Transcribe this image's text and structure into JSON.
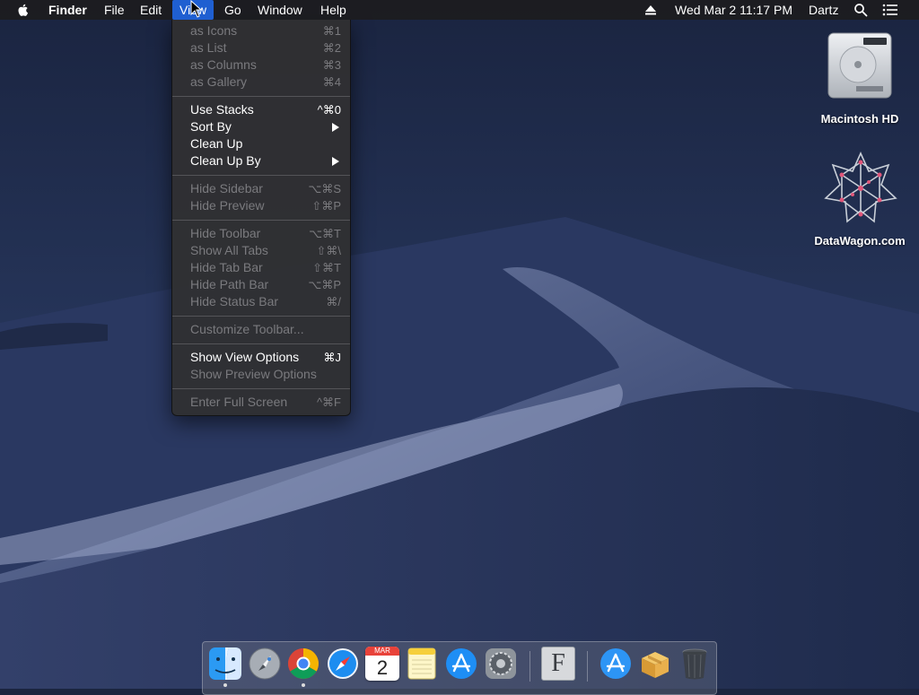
{
  "menubar": {
    "app_name": "Finder",
    "menus": [
      "File",
      "Edit",
      "View",
      "Go",
      "Window",
      "Help"
    ],
    "active_menu": "View",
    "clock": "Wed Mar 2  11:17 PM",
    "user": "Dartz"
  },
  "view_menu": {
    "items": [
      {
        "label": "as Icons",
        "shortcut": "⌘1",
        "enabled": false
      },
      {
        "label": "as List",
        "shortcut": "⌘2",
        "enabled": false
      },
      {
        "label": "as Columns",
        "shortcut": "⌘3",
        "enabled": false
      },
      {
        "label": "as Gallery",
        "shortcut": "⌘4",
        "enabled": false
      },
      {
        "label": "Use Stacks",
        "shortcut": "^⌘0",
        "enabled": true
      },
      {
        "label": "Sort By",
        "shortcut": "",
        "enabled": true,
        "submenu": true
      },
      {
        "label": "Clean Up",
        "shortcut": "",
        "enabled": true
      },
      {
        "label": "Clean Up By",
        "shortcut": "",
        "enabled": true,
        "submenu": true
      },
      {
        "label": "Hide Sidebar",
        "shortcut": "⌥⌘S",
        "enabled": false
      },
      {
        "label": "Hide Preview",
        "shortcut": "⇧⌘P",
        "enabled": false
      },
      {
        "label": "Hide Toolbar",
        "shortcut": "⌥⌘T",
        "enabled": false
      },
      {
        "label": "Show All Tabs",
        "shortcut": "⇧⌘\\",
        "enabled": false
      },
      {
        "label": "Hide Tab Bar",
        "shortcut": "⇧⌘T",
        "enabled": false
      },
      {
        "label": "Hide Path Bar",
        "shortcut": "⌥⌘P",
        "enabled": false
      },
      {
        "label": "Hide Status Bar",
        "shortcut": "⌘/",
        "enabled": false
      },
      {
        "label": "Customize Toolbar...",
        "shortcut": "",
        "enabled": false
      },
      {
        "label": "Show View Options",
        "shortcut": "⌘J",
        "enabled": true
      },
      {
        "label": "Show Preview Options",
        "shortcut": "",
        "enabled": false
      },
      {
        "label": "Enter Full Screen",
        "shortcut": "^⌘F",
        "enabled": false
      }
    ]
  },
  "desktop": {
    "icons": [
      {
        "label": "Macintosh HD",
        "icon": "hard-drive-icon"
      },
      {
        "label": "DataWagon.com",
        "icon": "network-star-icon"
      }
    ]
  },
  "dock": {
    "apps": [
      {
        "icon": "finder-icon",
        "running": true
      },
      {
        "icon": "launchpad-icon",
        "running": false
      },
      {
        "icon": "chrome-icon",
        "running": true
      },
      {
        "icon": "safari-icon",
        "running": false
      },
      {
        "icon": "calendar-icon",
        "running": false,
        "month": "MAR",
        "day": "2"
      },
      {
        "icon": "notes-icon",
        "running": false
      },
      {
        "icon": "app-store-icon",
        "running": false
      },
      {
        "icon": "system-preferences-icon",
        "running": false
      },
      {
        "icon": "font-book-icon",
        "running": false,
        "glyph": "F"
      },
      {
        "icon": "applications-folder-icon",
        "running": false
      },
      {
        "icon": "archive-utility-icon",
        "running": false
      },
      {
        "icon": "trash-icon",
        "running": false
      }
    ]
  },
  "colors": {
    "menu_highlight": "#1f5fd1",
    "disabled_text": "#7a7a7e"
  }
}
